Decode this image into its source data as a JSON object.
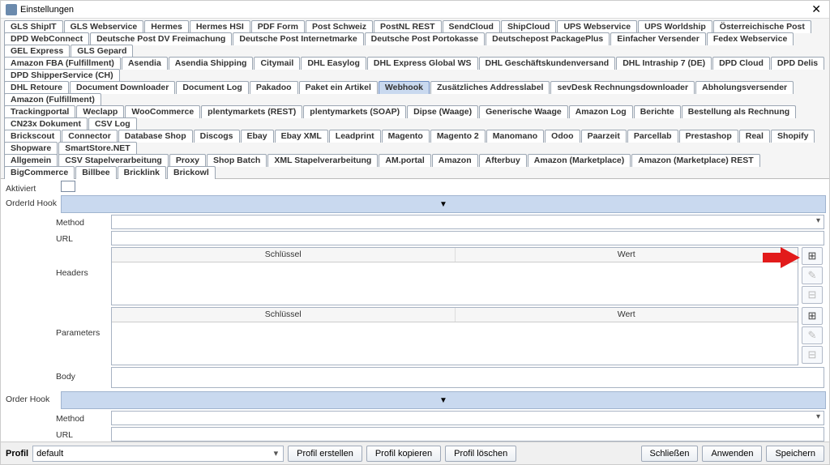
{
  "window": {
    "title": "Einstellungen"
  },
  "tabs": {
    "row1": [
      "GLS ShipIT",
      "GLS Webservice",
      "Hermes",
      "Hermes HSI",
      "PDF Form",
      "Post Schweiz",
      "PostNL REST",
      "SendCloud",
      "ShipCloud",
      "UPS Webservice",
      "UPS Worldship",
      "Österreichische Post"
    ],
    "row2": [
      "DPD WebConnect",
      "Deutsche Post DV Freimachung",
      "Deutsche Post Internetmarke",
      "Deutsche Post Portokasse",
      "Deutschepost PackagePlus",
      "Einfacher Versender",
      "Fedex Webservice",
      "GEL Express",
      "GLS Gepard"
    ],
    "row3": [
      "Amazon FBA (Fulfillment)",
      "Asendia",
      "Asendia Shipping",
      "Citymail",
      "DHL Easylog",
      "DHL Express Global WS",
      "DHL Geschäftskundenversand",
      "DHL Intraship 7 (DE)",
      "DPD Cloud",
      "DPD Delis",
      "DPD ShipperService (CH)"
    ],
    "row4": [
      "DHL Retoure",
      "Document Downloader",
      "Document Log",
      "Pakadoo",
      "Paket ein Artikel",
      "Webhook",
      "Zusätzliches Addresslabel",
      "sevDesk Rechnungsdownloader",
      "Abholungsversender",
      "Amazon (Fulfillment)"
    ],
    "row5": [
      "Trackingportal",
      "Weclapp",
      "WooCommerce",
      "plentymarkets (REST)",
      "plentymarkets (SOAP)",
      "Dipse (Waage)",
      "Generische Waage",
      "Amazon Log",
      "Berichte",
      "Bestellung als Rechnung",
      "CN23x Dokument",
      "CSV Log"
    ],
    "row6": [
      "Brickscout",
      "Connector",
      "Database Shop",
      "Discogs",
      "Ebay",
      "Ebay XML",
      "Leadprint",
      "Magento",
      "Magento 2",
      "Manomano",
      "Odoo",
      "Paarzeit",
      "Parcellab",
      "Prestashop",
      "Real",
      "Shopify",
      "Shopware",
      "SmartStore.NET"
    ],
    "row7": [
      "Allgemein",
      "CSV Stapelverarbeitung",
      "Proxy",
      "Shop Batch",
      "XML Stapelverarbeitung",
      "AM.portal",
      "Amazon",
      "Afterbuy",
      "Amazon (Marketplace)",
      "Amazon (Marketplace) REST",
      "BigCommerce",
      "Billbee",
      "Bricklink",
      "Brickowl"
    ]
  },
  "selected_tab": "Webhook",
  "form": {
    "aktiviert_label": "Aktiviert",
    "orderid_hook_label": "OrderId Hook",
    "method_label": "Method",
    "url_label": "URL",
    "headers_label": "Headers",
    "parameters_label": "Parameters",
    "body_label": "Body",
    "order_hook_label": "Order Hook",
    "kv_key": "Schlüssel",
    "kv_val": "Wert"
  },
  "footer": {
    "profil_label": "Profil",
    "profil_value": "default",
    "erstellen": "Profil erstellen",
    "kopieren": "Profil kopieren",
    "loeschen": "Profil löschen",
    "schliessen": "Schließen",
    "anwenden": "Anwenden",
    "speichern": "Speichern"
  }
}
